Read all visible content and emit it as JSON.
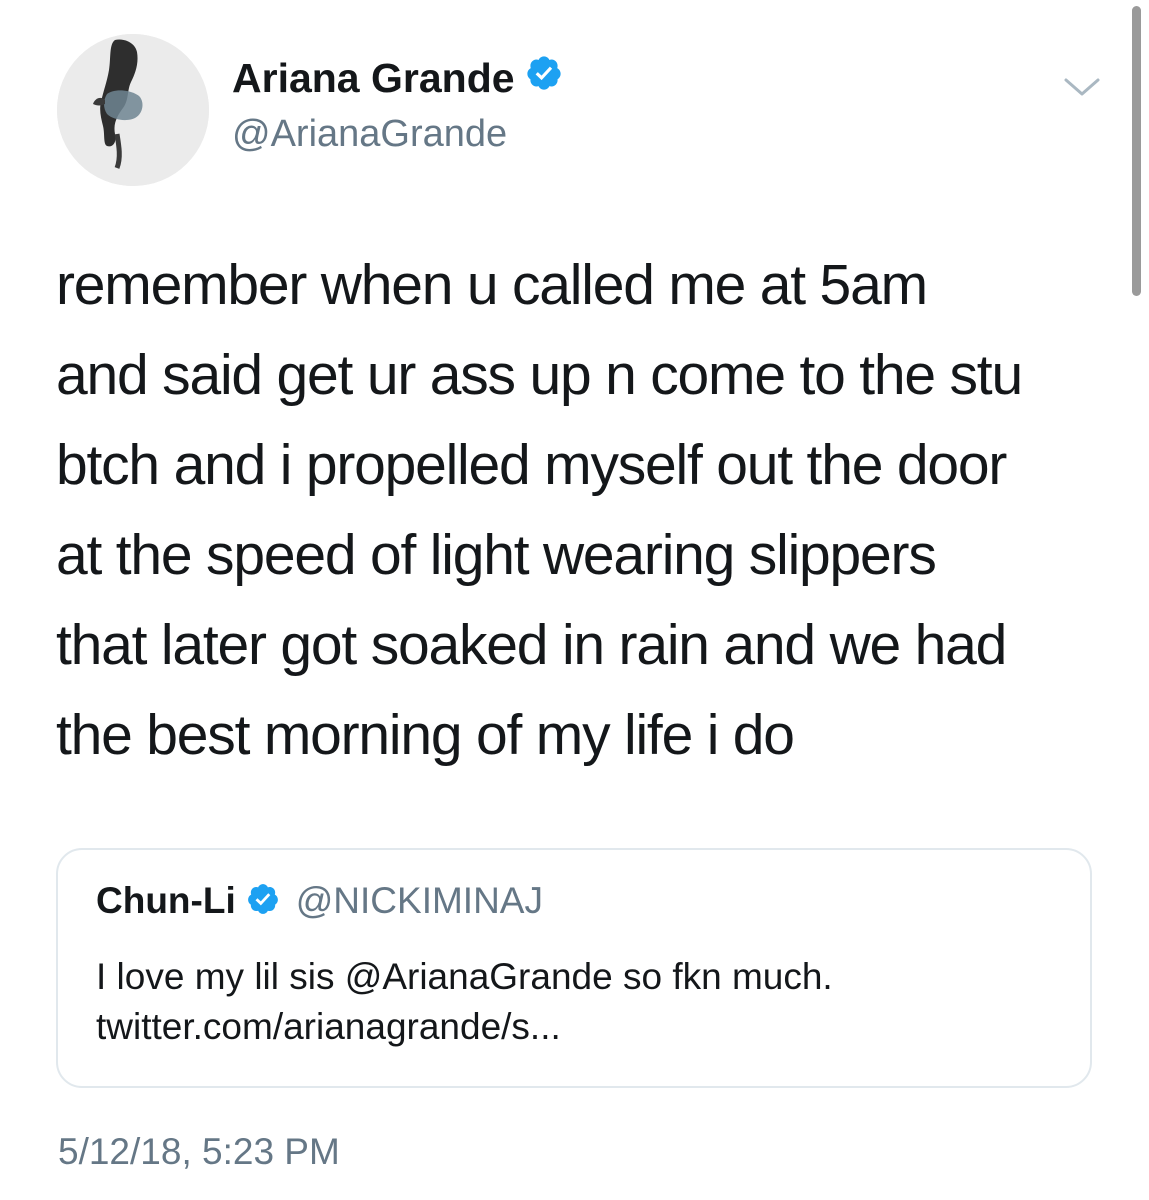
{
  "author": {
    "display_name": "Ariana Grande",
    "handle": "@ArianaGrande",
    "verified": true
  },
  "tweet": {
    "lines": [
      "remember when u called me at 5am",
      "and said get ur ass up n come to the stu",
      "btch and i propelled myself out the door",
      "at the speed of light wearing slippers",
      "that later got soaked in rain and we had",
      "the best morning of my life i do"
    ],
    "timestamp": "5/12/18, 5:23 PM"
  },
  "quoted_tweet": {
    "display_name": "Chun-Li",
    "handle": "@NICKIMINAJ",
    "verified": true,
    "lines": [
      "I love my lil sis @ArianaGrande so fkn much.",
      "twitter.com/arianagrande/s..."
    ]
  },
  "icons": {
    "verified": "verified-badge-icon",
    "menu": "chevron-down-icon"
  },
  "colors": {
    "verified_blue": "#1da1f2",
    "secondary_text": "#657786",
    "primary_text": "#14171a",
    "card_border": "#e1e8ed"
  }
}
